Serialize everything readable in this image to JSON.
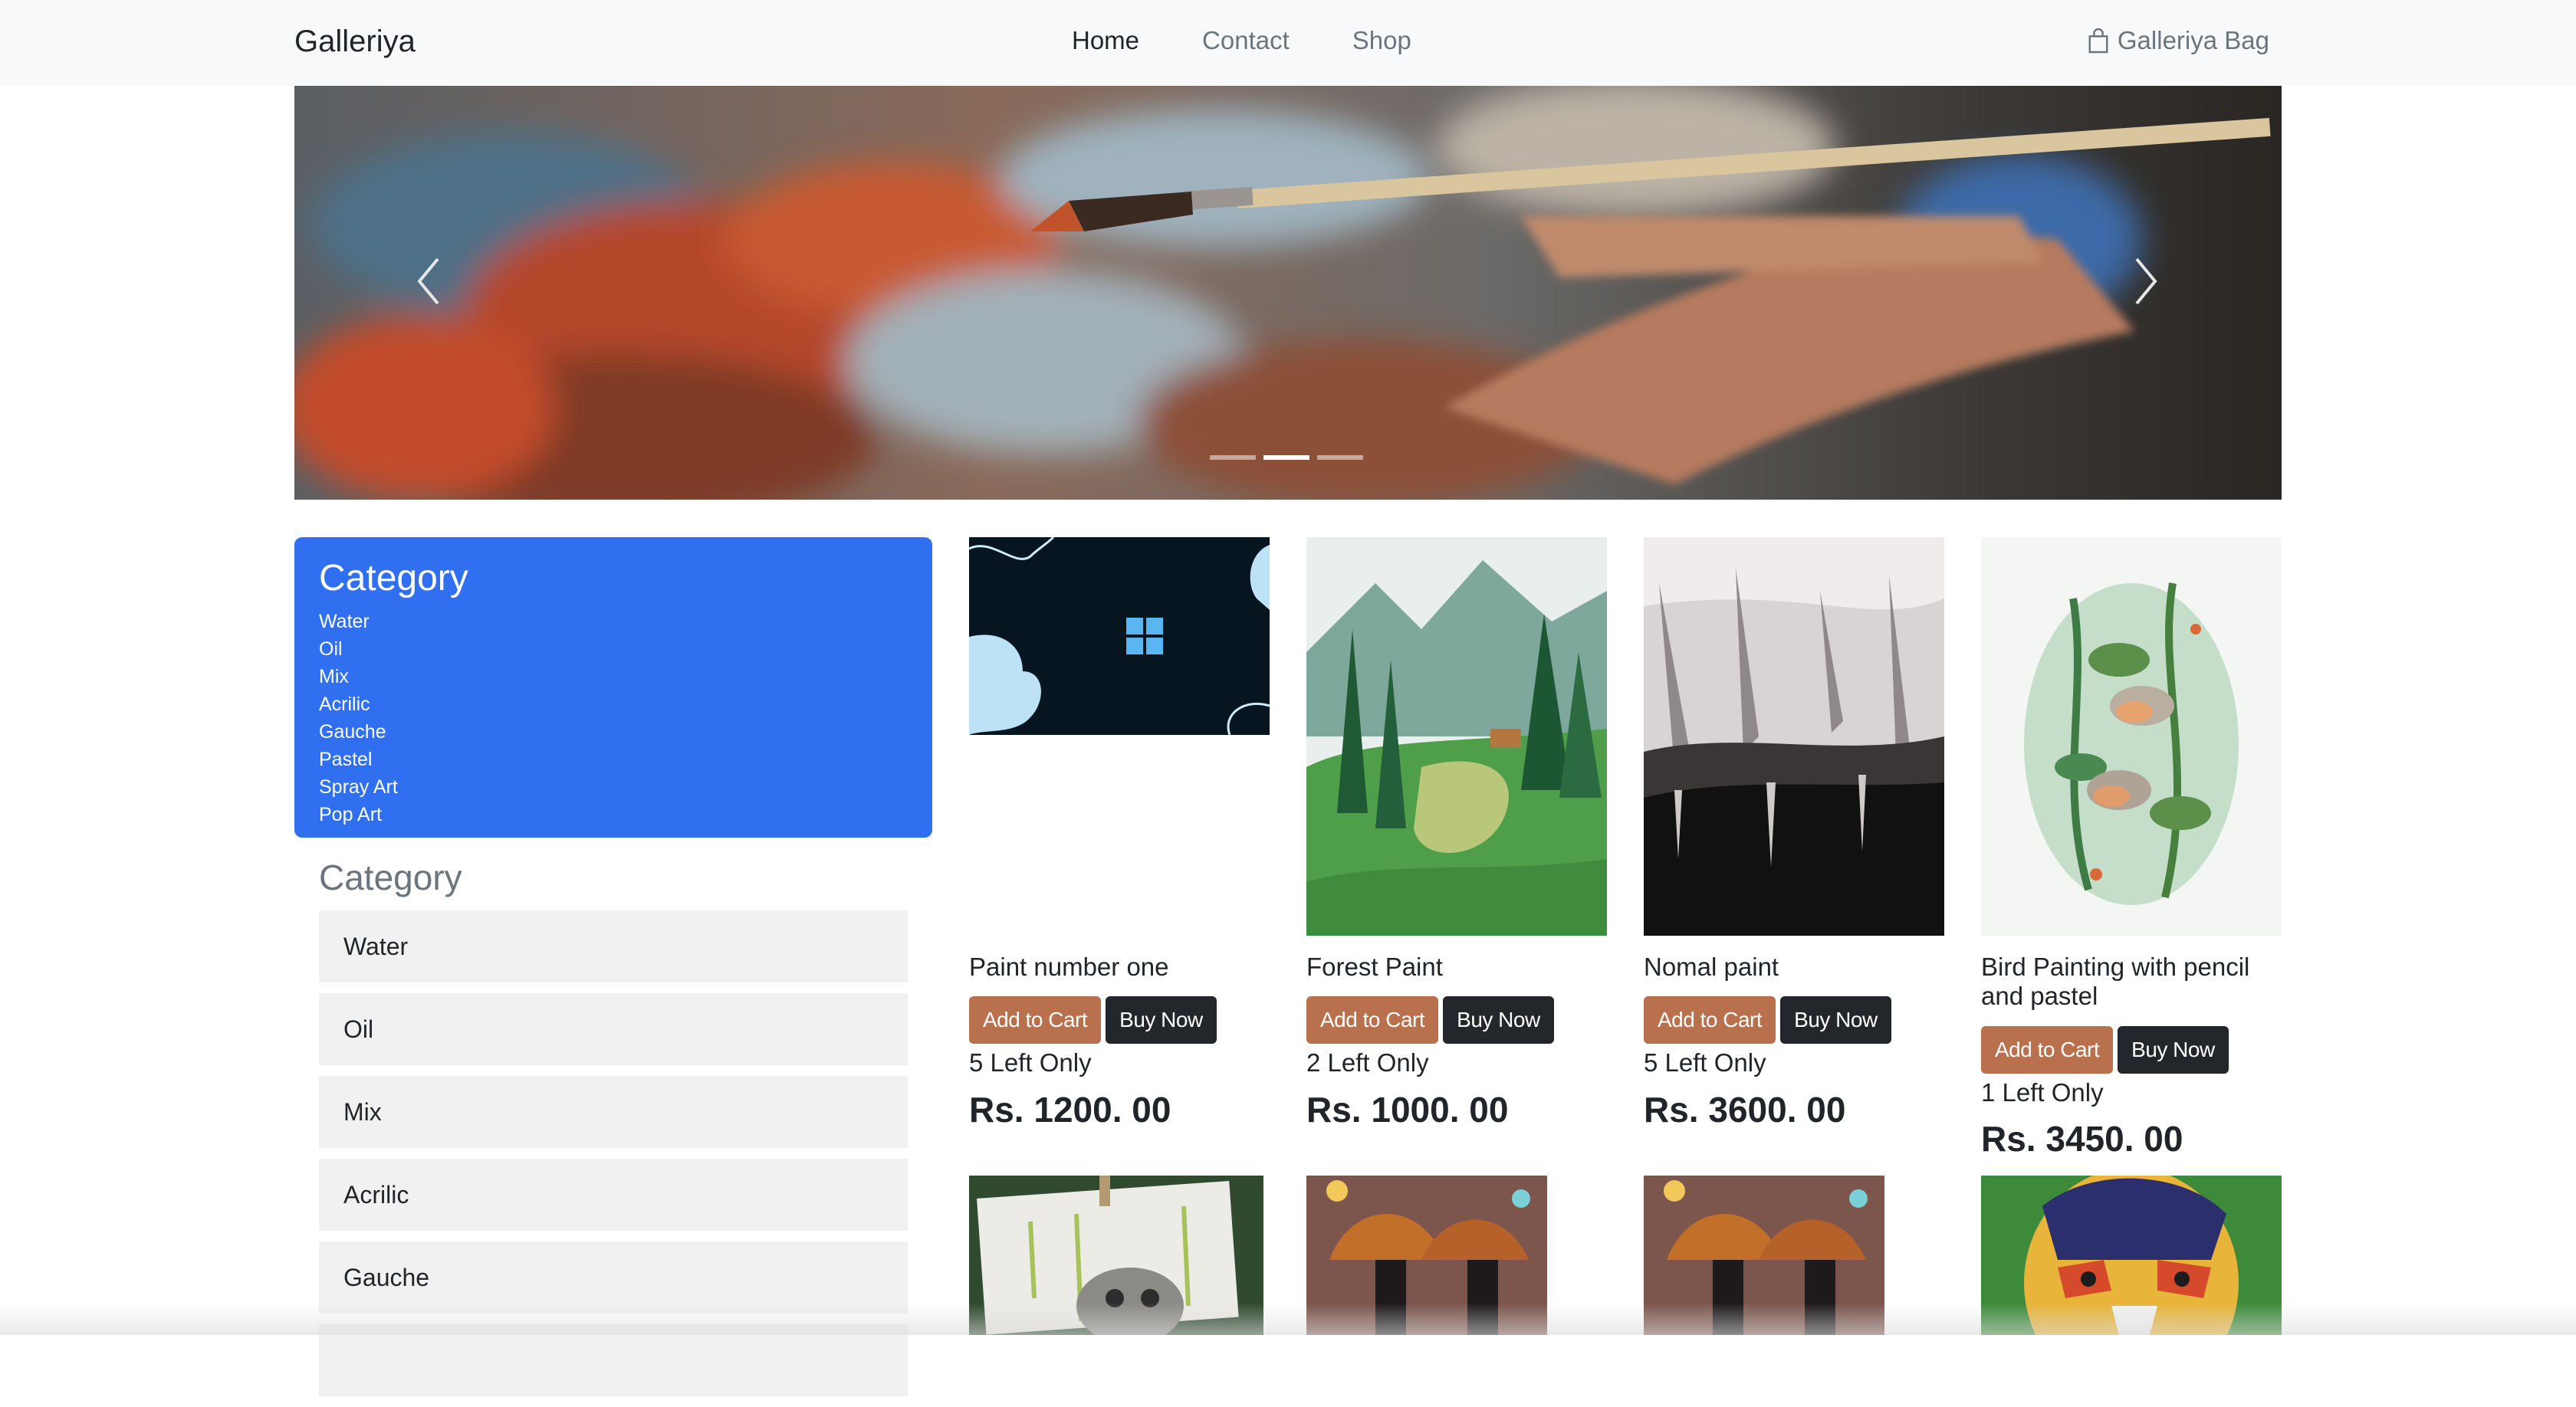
{
  "navbar": {
    "brand": "Galleriya",
    "links": [
      "Home",
      "Contact",
      "Shop"
    ],
    "bag_label": "Galleriya Bag"
  },
  "carousel": {
    "slide_count": 3,
    "active_slide": 2
  },
  "sidebar": {
    "box_title": "Category",
    "box_items": [
      "Water",
      "Oil",
      "Mix",
      "Acrilic",
      "Gauche",
      "Pastel",
      "Spray Art",
      "Pop Art"
    ],
    "list_title": "Category",
    "list_items": [
      "Water",
      "Oil",
      "Mix",
      "Acrilic",
      "Gauche"
    ]
  },
  "buttons": {
    "add_to_cart": "Add to Cart",
    "buy_now": "Buy Now"
  },
  "products": [
    {
      "name": "Paint number one",
      "stock": "5 Left Only",
      "price": "Rs. 1200. 00"
    },
    {
      "name": "Forest Paint",
      "stock": "2 Left Only",
      "price": "Rs. 1000. 00"
    },
    {
      "name": "Nomal paint",
      "stock": "5 Left Only",
      "price": "Rs. 3600. 00"
    },
    {
      "name": "Bird Painting with pencil and pastel",
      "stock": "1 Left Only",
      "price": "Rs. 3450. 00"
    }
  ],
  "colors": {
    "navbar_bg": "#f8f9fa",
    "category_box_bg": "#2f6ff0",
    "add_to_cart_bg": "#b8704d",
    "buy_now_bg": "#23272b"
  }
}
